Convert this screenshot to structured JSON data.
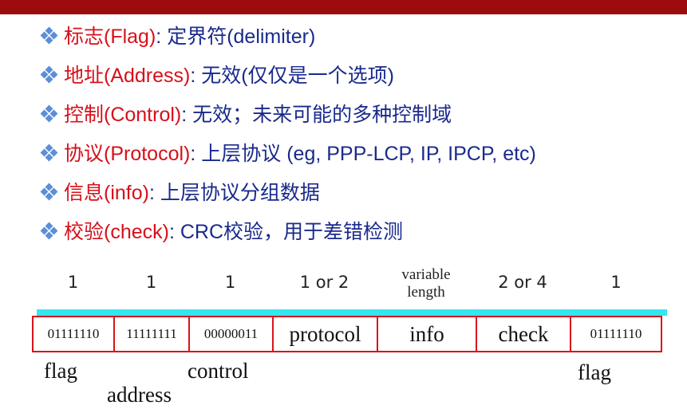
{
  "bullets": [
    {
      "term": "标志(Flag)",
      "desc": ": 定界符(delimiter)"
    },
    {
      "term": "地址(Address)",
      "desc": ":  无效(仅仅是一个选项)"
    },
    {
      "term": "控制(Control)",
      "desc": ": 无效；未来可能的多种控制域"
    },
    {
      "term": "协议(Protocol)",
      "desc": ": 上层协议 (eg, PPP-LCP, IP, IPCP, etc)"
    },
    {
      "term": "信息(info)",
      "desc": ": 上层协议分组数据"
    },
    {
      "term": "校验(check)",
      "desc": ":  CRC校验，用于差错检测"
    }
  ],
  "frame": {
    "sizes": [
      "1",
      "1",
      "1",
      "1 or 2",
      "variable length",
      "2 or 4",
      "1"
    ],
    "fields": [
      "01111110",
      "11111111",
      "00000011",
      "protocol",
      "info",
      "check",
      "01111110"
    ],
    "under_labels": {
      "flag_left": "flag",
      "address": "address",
      "control": "control",
      "flag_right": "flag"
    }
  },
  "colors": {
    "topbar": "#9e0b0f",
    "term": "#d6101a",
    "desc": "#1a2a8c",
    "field_border": "#d8141c",
    "cyan_bar": "#33e6f0",
    "bullet_icon": "#5b8fd6"
  },
  "icons": {
    "bullet": "diamond-cluster-icon"
  }
}
